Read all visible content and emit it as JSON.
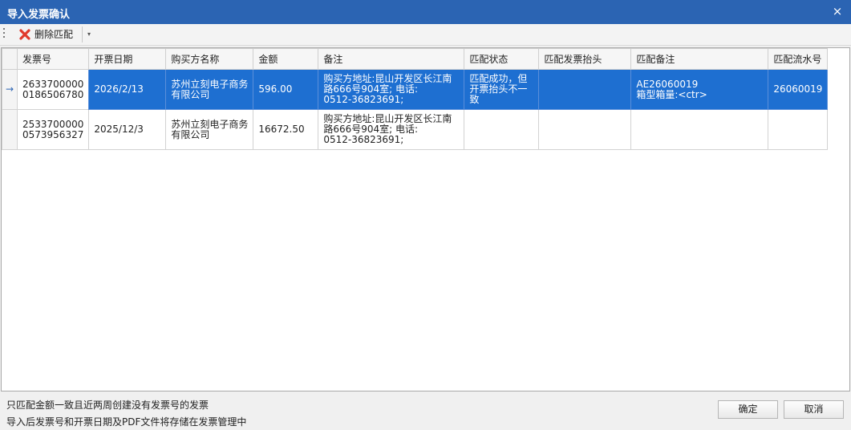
{
  "window": {
    "title": "导入发票确认",
    "close_icon": "×"
  },
  "toolbar": {
    "delete_match_label": "删除匹配",
    "dropdown_icon": "▾"
  },
  "grid": {
    "columns": [
      "发票号",
      "开票日期",
      "购买方名称",
      "金额",
      "备注",
      "匹配状态",
      "匹配发票抬头",
      "匹配备注",
      "匹配流水号"
    ],
    "selected_row_indicator": "→",
    "rows": [
      {
        "invoice_no_1": "2633700000",
        "invoice_no_2": "0186506780",
        "date": "2026/2/13",
        "buyer_1": "苏州立刻电子商务",
        "buyer_2": "有限公司",
        "amount": "596.00",
        "remark_1": "购买方地址:昆山开发区长江南",
        "remark_2": "路666号904室; 电话:",
        "remark_3": "0512-36823691;",
        "status_1": "匹配成功，但",
        "status_2": "开票抬头不一",
        "status_3": "致",
        "matched_title": "",
        "match_remark_1": "AE26060019",
        "match_remark_2": "箱型箱量:<ctr>",
        "serial": "26060019"
      },
      {
        "invoice_no_1": "2533700000",
        "invoice_no_2": "0573956327",
        "date": "2025/12/3",
        "buyer_1": "苏州立刻电子商务",
        "buyer_2": "有限公司",
        "amount": "16672.50",
        "remark_1": "购买方地址:昆山开发区长江南",
        "remark_2": "路666号904室; 电话:",
        "remark_3": "0512-36823691;",
        "status_1": "",
        "status_2": "",
        "status_3": "",
        "matched_title": "",
        "match_remark_1": "",
        "match_remark_2": "",
        "serial": ""
      }
    ]
  },
  "footer": {
    "note_1": "只匹配金额一致且近两周创建没有发票号的发票",
    "note_2": "导入后发票号和开票日期及PDF文件将存储在发票管理中",
    "confirm_label": "确定",
    "cancel_label": "取消"
  },
  "colors": {
    "title_bar": "#2b64b3",
    "selection": "#1e6fd1",
    "delete_icon": "#e03a2c"
  }
}
